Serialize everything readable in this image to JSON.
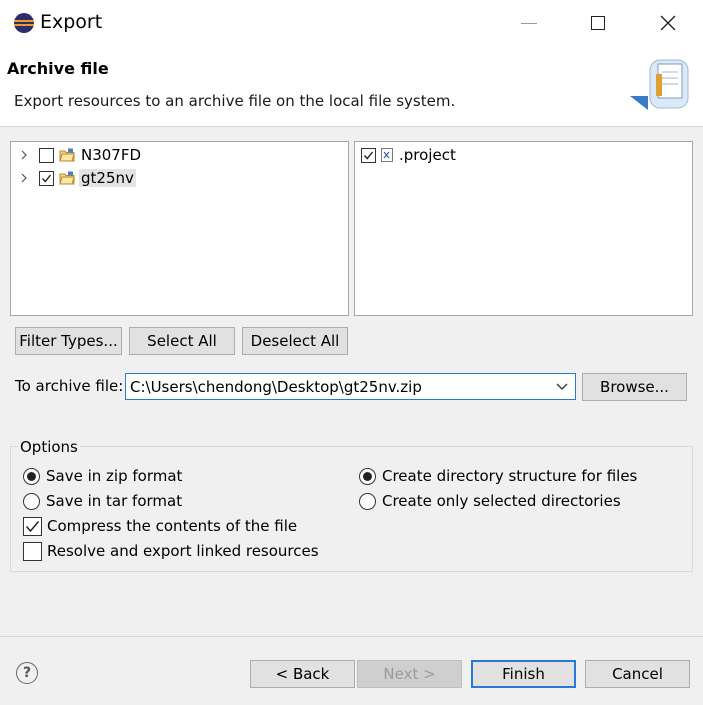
{
  "window": {
    "title": "Export"
  },
  "header": {
    "title": "Archive file",
    "description": "Export resources to an archive file on the local file system."
  },
  "left_tree": {
    "items": [
      {
        "label": "N307FD",
        "checked": false
      },
      {
        "label": "gt25nv",
        "checked": true,
        "selected": true
      }
    ]
  },
  "right_list": {
    "items": [
      {
        "label": ".project",
        "checked": true
      }
    ]
  },
  "selection_buttons": {
    "filter": "Filter Types...",
    "select_all": "Select All",
    "deselect_all": "Deselect All"
  },
  "archive": {
    "label": "To archive file:",
    "value": "C:\\Users\\chendong\\Desktop\\gt25nv.zip",
    "browse": "Browse..."
  },
  "options": {
    "group_label": "Options",
    "zip": "Save in zip format",
    "tar": "Save in tar format",
    "compress": "Compress the contents of the file",
    "resolve": "Resolve and export linked resources",
    "create_dir": "Create directory structure for files",
    "create_selected": "Create only selected directories",
    "format_selected": "zip",
    "structure_selected": "create_dir",
    "compress_checked": true,
    "resolve_checked": false
  },
  "footer": {
    "back": "< Back",
    "next": "Next >",
    "finish": "Finish",
    "cancel": "Cancel",
    "help": "?"
  }
}
